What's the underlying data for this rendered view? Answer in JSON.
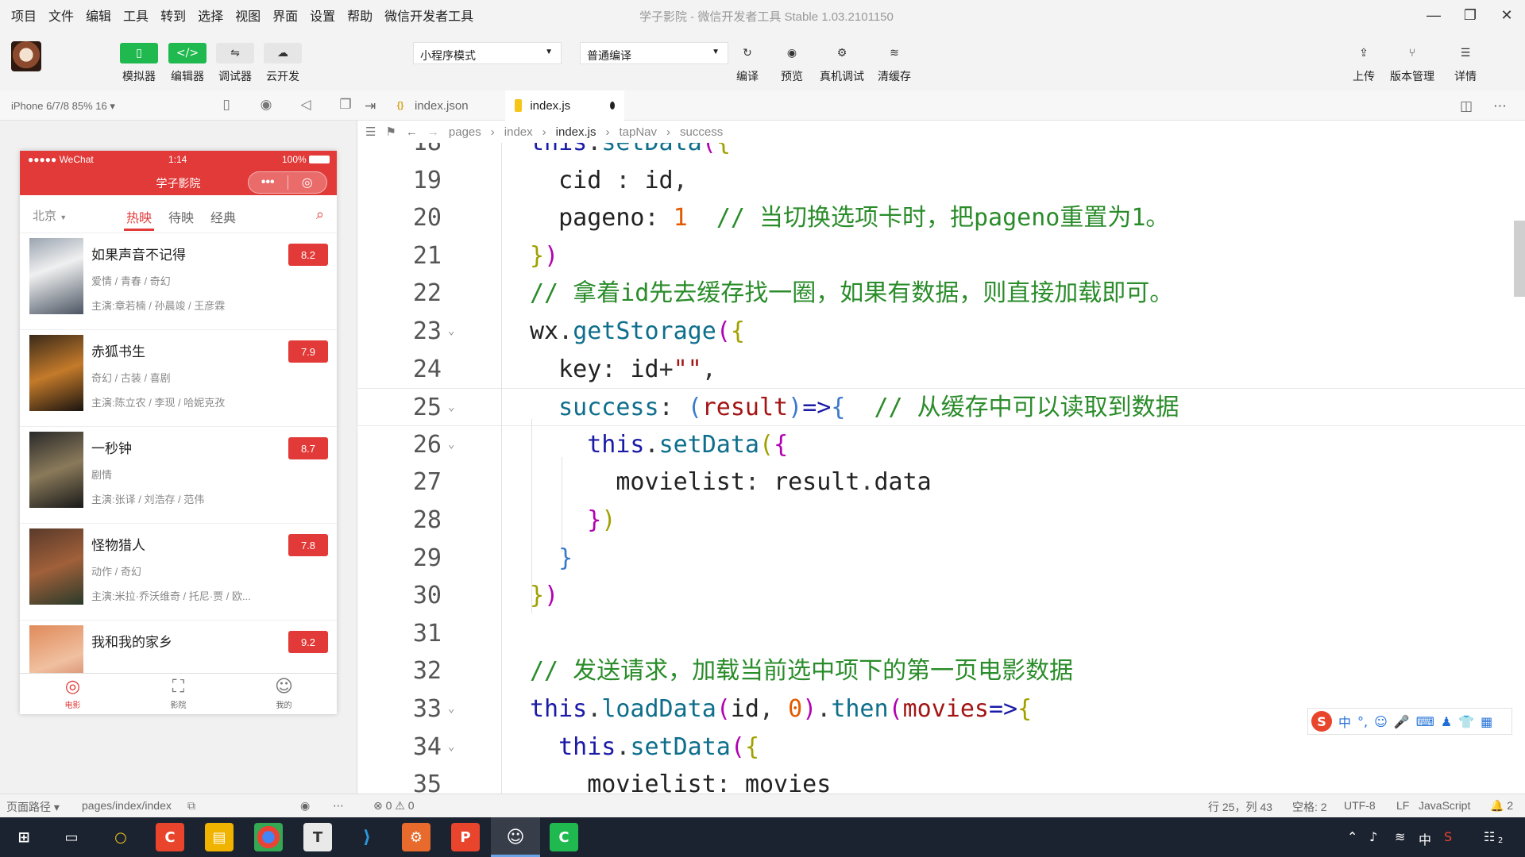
{
  "menu": [
    "项目",
    "文件",
    "编辑",
    "工具",
    "转到",
    "选择",
    "视图",
    "界面",
    "设置",
    "帮助",
    "微信开发者工具"
  ],
  "window_title": "学子影院 - 微信开发者工具 Stable 1.03.2101150",
  "window_controls": {
    "minimize": "—",
    "restore": "❐",
    "close": "✕"
  },
  "toolbar": {
    "buttons": [
      {
        "label": "模拟器",
        "icon": "▯"
      },
      {
        "label": "编辑器",
        "icon": "</>"
      },
      {
        "label": "调试器",
        "icon": "⇋"
      },
      {
        "label": "云开发",
        "icon": "☁"
      }
    ],
    "mode_select": "小程序模式",
    "compile_select": "普通编译",
    "actions": [
      {
        "label": "编译",
        "icon": "↻"
      },
      {
        "label": "预览",
        "icon": "◉"
      },
      {
        "label": "真机调试",
        "icon": "⚙"
      },
      {
        "label": "清缓存",
        "icon": "≋"
      }
    ],
    "right": [
      {
        "label": "上传",
        "icon": "⇪"
      },
      {
        "label": "版本管理",
        "icon": "⑂"
      },
      {
        "label": "详情",
        "icon": "☰"
      }
    ]
  },
  "device": "iPhone 6/7/8 85% 16 ▾",
  "tabs": [
    {
      "name": "index.json",
      "icon": "{}",
      "active": false
    },
    {
      "name": "index.js",
      "icon": "JS",
      "active": true
    }
  ],
  "breadcrumb": [
    "pages",
    "index",
    "index.js",
    "tapNav",
    "success"
  ],
  "phone": {
    "status_left": "●●●●● WeChat",
    "time": "1:14",
    "battery": "100%",
    "title": "学子影院",
    "city": "北京",
    "tabs": [
      "热映",
      "待映",
      "经典"
    ],
    "movies": [
      {
        "name": "如果声音不记得",
        "type": "爱情 / 青春 / 奇幻",
        "actors": "主演:章若楠 / 孙晨竣 / 王彦霖",
        "score": "8.2"
      },
      {
        "name": "赤狐书生",
        "type": "奇幻 / 古装 / 喜剧",
        "actors": "主演:陈立农 / 李现 / 哈妮克孜",
        "score": "7.9"
      },
      {
        "name": "一秒钟",
        "type": "剧情",
        "actors": "主演:张译 / 刘浩存 / 范伟",
        "score": "8.7"
      },
      {
        "name": "怪物猎人",
        "type": "动作 / 奇幻",
        "actors": "主演:米拉·乔沃维奇 / 托尼·贾 / 欧...",
        "score": "7.8"
      },
      {
        "name": "我和我的家乡",
        "type": "",
        "actors": "",
        "score": "9.2"
      }
    ],
    "tabbar": [
      {
        "label": "电影",
        "icon": "◎"
      },
      {
        "label": "影院",
        "icon": "⛶"
      },
      {
        "label": "我的",
        "icon": "☺"
      }
    ]
  },
  "code_lines": [
    {
      "n": "18",
      "html": "<span class='kw'>this</span>.<span class='fn'>setData</span><span class='br1'>(</span><span class='br2'>{</span>"
    },
    {
      "n": "19",
      "html": "  <span class='pr'>cid</span> : <span class='pr'>id</span>,"
    },
    {
      "n": "20",
      "html": "  <span class='pr'>pageno</span>: <span class='nm'>1</span>  <span class='cm'>// 当切换选项卡时，把pageno重置为1。</span>"
    },
    {
      "n": "21",
      "html": "<span class='br2'>}</span><span class='br1'>)</span>"
    },
    {
      "n": "22",
      "html": "<span class='cm'>// 拿着id先去缓存找一圈，如果有数据，则直接加载即可。</span>"
    },
    {
      "n": "23",
      "html": "<span class='pr'>wx</span>.<span class='fn'>getStorage</span><span class='br1'>(</span><span class='br2'>{</span>",
      "fold": true
    },
    {
      "n": "24",
      "html": "  <span class='pr'>key</span>: <span class='pr'>id</span>+<span class='st'>\"\"</span>,"
    },
    {
      "n": "25",
      "html": "  <span class='fn'>success</span>: <span class='br3'>(</span><span class='st'>result</span><span class='br3'>)</span><span class='kw'>=></span><span class='br3'>{</span>  <span class='cm'>// 从缓存中可以读取到数据</span>",
      "fold": true,
      "cur": true
    },
    {
      "n": "26",
      "html": "    <span class='kw'>this</span>.<span class='fn'>setData</span><span class='br2'>(</span><span class='br1'>{</span>",
      "fold": true
    },
    {
      "n": "27",
      "html": "      <span class='pr'>movielist</span>: <span class='pr'>result</span>.<span class='pr'>data</span>"
    },
    {
      "n": "28",
      "html": "    <span class='br1'>}</span><span class='br2'>)</span>"
    },
    {
      "n": "29",
      "html": "  <span class='br3'>}</span>"
    },
    {
      "n": "30",
      "html": "<span class='br2'>}</span><span class='br1'>)</span>"
    },
    {
      "n": "31",
      "html": ""
    },
    {
      "n": "32",
      "html": "<span class='cm'>// 发送请求，加载当前选中项下的第一页电影数据</span>"
    },
    {
      "n": "33",
      "html": "<span class='kw'>this</span>.<span class='fn'>loadData</span><span class='br1'>(</span><span class='pr'>id</span>, <span class='nm'>0</span><span class='br1'>)</span>.<span class='fn'>then</span><span class='br1'>(</span><span class='st'>movies</span><span class='kw'>=></span><span class='br2'>{</span>",
      "fold": true
    },
    {
      "n": "34",
      "html": "  <span class='kw'>this</span>.<span class='fn'>setData</span><span class='br1'>(</span><span class='br2'>{</span>",
      "fold": true
    },
    {
      "n": "35",
      "html": "    <span class='pr'>movielist</span>: <span class='pr'>movies</span>"
    }
  ],
  "statusbar": {
    "path_label": "页面路径 ▾",
    "path": "pages/index/index",
    "problems": "⊗ 0 ⚠ 0",
    "cursor": "行 25，列 43",
    "indent": "空格: 2",
    "encoding": "UTF-8",
    "eol": "LF",
    "language": "JavaScript",
    "notifications": "🔔 2"
  },
  "ime": [
    "中",
    "°,",
    "☺",
    "🎤",
    "⌨",
    "♟",
    "👕",
    "▦"
  ],
  "taskbar": {
    "tray_ime": "中",
    "notify_count": "2"
  }
}
